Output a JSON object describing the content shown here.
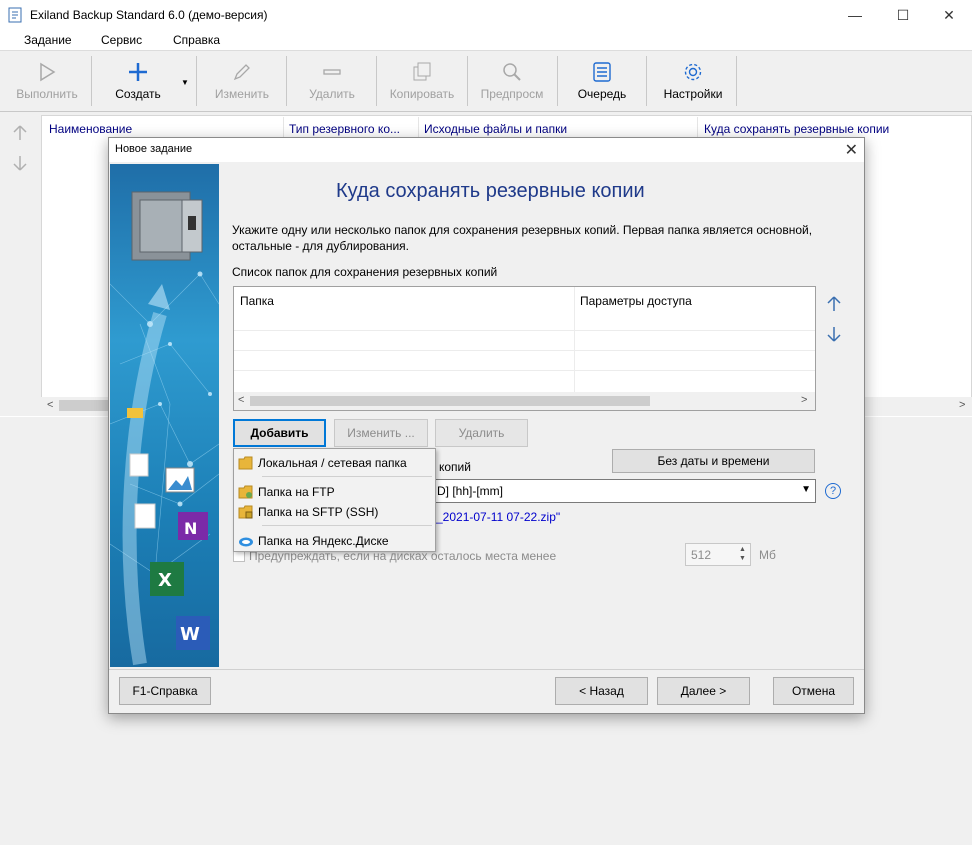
{
  "window": {
    "title": "Exiland Backup Standard 6.0 (демо-версия)",
    "minimize": "—",
    "maximize": "☐",
    "close": "✕"
  },
  "menu": [
    "Задание",
    "Сервис",
    "Справка"
  ],
  "toolbar": {
    "run": "Выполнить",
    "create": "Создать",
    "edit": "Изменить",
    "delete": "Удалить",
    "copy": "Копировать",
    "preview": "Предпросм",
    "queue": "Очередь",
    "settings": "Настройки"
  },
  "task_list": {
    "columns": [
      "Наименование",
      "Тип резервного ко...",
      "Исходные файлы и папки",
      "Куда сохранять резервные копии"
    ]
  },
  "dialog": {
    "title": "Новое задание",
    "close": "✕",
    "heading": "Куда сохранять резервные копии",
    "instruction": "Укажите одну или несколько папок для сохранения резервных копий. Первая папка является основной, остальные - для дублирования.",
    "list_label": "Список папок для сохранения резервных копий",
    "grid_columns": [
      "Папка",
      "Параметры доступа"
    ],
    "buttons": {
      "add": "Добавить",
      "edit": "Изменить ...",
      "delete": "Удалить",
      "no_date": "Без даты и времени"
    },
    "pattern_label_tail": "копий",
    "pattern_value_tail": "D] [hh]-[mm]",
    "preview_tail": "_2021-07-11 07-22.zip\"",
    "warn_label": "Предупреждать, если на дисках осталось места менее",
    "warn_value": "512",
    "warn_unit": "Мб",
    "help": "?",
    "footer": {
      "help": "F1-Справка",
      "back": "< Назад",
      "next": "Далее >",
      "cancel": "Отмена"
    }
  },
  "add_menu": {
    "items": [
      "Локальная / сетевая папка",
      "Папка на FTP",
      "Папка на SFTP (SSH)",
      "Папка на Яндекс.Диске"
    ]
  },
  "colors": {
    "heading": "#1f3a8a",
    "accent": "#0078d7",
    "header_text": "#000080",
    "link": "#0000cc"
  }
}
